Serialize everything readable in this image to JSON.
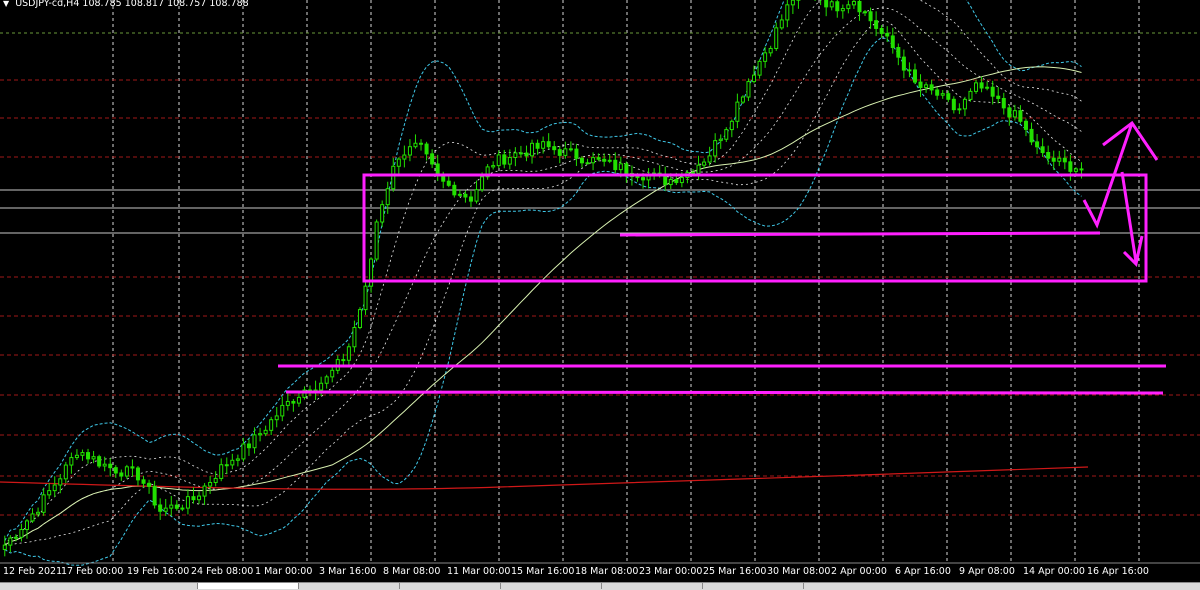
{
  "header": {
    "symbol_timeframe": "USDJPY-cd,H4",
    "ohlc": [
      "108.785",
      "108.817",
      "108.757",
      "108.788"
    ]
  },
  "colors": {
    "background": "#000000",
    "grid": "#ffffff",
    "candle": "#22e000",
    "bollinger_outer": "#3fc8e8",
    "bollinger_inner": "#e8e8e8",
    "ma_slow": "#d8f0b0",
    "ma_long": "#d01818",
    "level_red": "#a01818",
    "level_white": "#c8c8c8",
    "annotation": "#ff20ff"
  },
  "chart_data": {
    "type": "candlestick",
    "symbol": "USDJPY-cd",
    "timeframe": "H4",
    "x_tick_labels": [
      "12 Feb 2021",
      "17 Feb 00:00",
      "19 Feb 16:00",
      "24 Feb 08:00",
      "1 Mar 00:00",
      "3 Mar 16:00",
      "8 Mar 08:00",
      "11 Mar 00:00",
      "15 Mar 16:00",
      "18 Mar 08:00",
      "23 Mar 00:00",
      "25 Mar 16:00",
      "30 Mar 08:00",
      "2 Apr 00:00",
      "6 Apr 16:00",
      "9 Apr 08:00",
      "14 Apr 00:00",
      "16 Apr 16:00"
    ],
    "last_bar": {
      "open": 108.785,
      "high": 108.817,
      "low": 108.757,
      "close": 108.788
    },
    "close_path_approx": [
      [
        0,
        104.45
      ],
      [
        3,
        104.85
      ],
      [
        6,
        105.35
      ],
      [
        7,
        105.55
      ],
      [
        10,
        105.35
      ],
      [
        13,
        105.25
      ],
      [
        15,
        104.85
      ],
      [
        18,
        104.95
      ],
      [
        21,
        105.35
      ],
      [
        24,
        105.65
      ],
      [
        27,
        106.05
      ],
      [
        29,
        106.25
      ],
      [
        31,
        106.35
      ],
      [
        33,
        106.65
      ],
      [
        35,
        107.45
      ],
      [
        36,
        108.25
      ],
      [
        38,
        108.95
      ],
      [
        40,
        109.05
      ],
      [
        42,
        108.65
      ],
      [
        45,
        108.45
      ],
      [
        47,
        108.85
      ],
      [
        49,
        108.95
      ],
      [
        52,
        109.05
      ],
      [
        55,
        108.95
      ],
      [
        58,
        108.85
      ],
      [
        61,
        108.75
      ],
      [
        64,
        108.65
      ],
      [
        66,
        108.75
      ],
      [
        68,
        108.95
      ],
      [
        70,
        109.35
      ],
      [
        72,
        109.85
      ],
      [
        74,
        110.25
      ],
      [
        76,
        110.75
      ],
      [
        78,
        110.85
      ],
      [
        80,
        110.65
      ],
      [
        82,
        110.75
      ],
      [
        84,
        110.45
      ],
      [
        86,
        110.15
      ],
      [
        88,
        109.75
      ],
      [
        90,
        109.65
      ],
      [
        92,
        109.45
      ],
      [
        94,
        109.75
      ],
      [
        96,
        109.55
      ],
      [
        98,
        109.35
      ],
      [
        100,
        108.95
      ],
      [
        102,
        108.85
      ],
      [
        104,
        108.79
      ]
    ],
    "indicators": [
      "Bollinger Bands (cyan dotted)",
      "inner envelopes (white dotted)",
      "moving average (pale green)",
      "long moving average (red)"
    ],
    "grid": true
  }
}
